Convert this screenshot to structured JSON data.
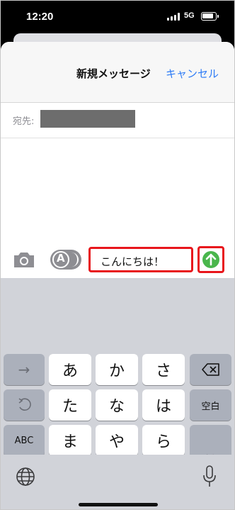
{
  "status_bar": {
    "time": "12:20",
    "network": "5G"
  },
  "header": {
    "title": "新規メッセージ",
    "cancel_label": "キャンセル"
  },
  "recipient": {
    "label": "宛先:"
  },
  "input": {
    "text": "こんにちは！"
  },
  "keyboard": {
    "row1": [
      "→",
      "あ",
      "か",
      "さ"
    ],
    "row2": [
      "た",
      "な",
      "は",
      "空白"
    ],
    "row3": [
      "ABC",
      "ま",
      "や",
      "ら",
      "改行"
    ],
    "row4": [
      "^^",
      "わ_",
      "、。?!"
    ]
  },
  "colors": {
    "accent": "#2f7cf6",
    "send": "#4ab64c",
    "highlight": "#e8161c"
  }
}
